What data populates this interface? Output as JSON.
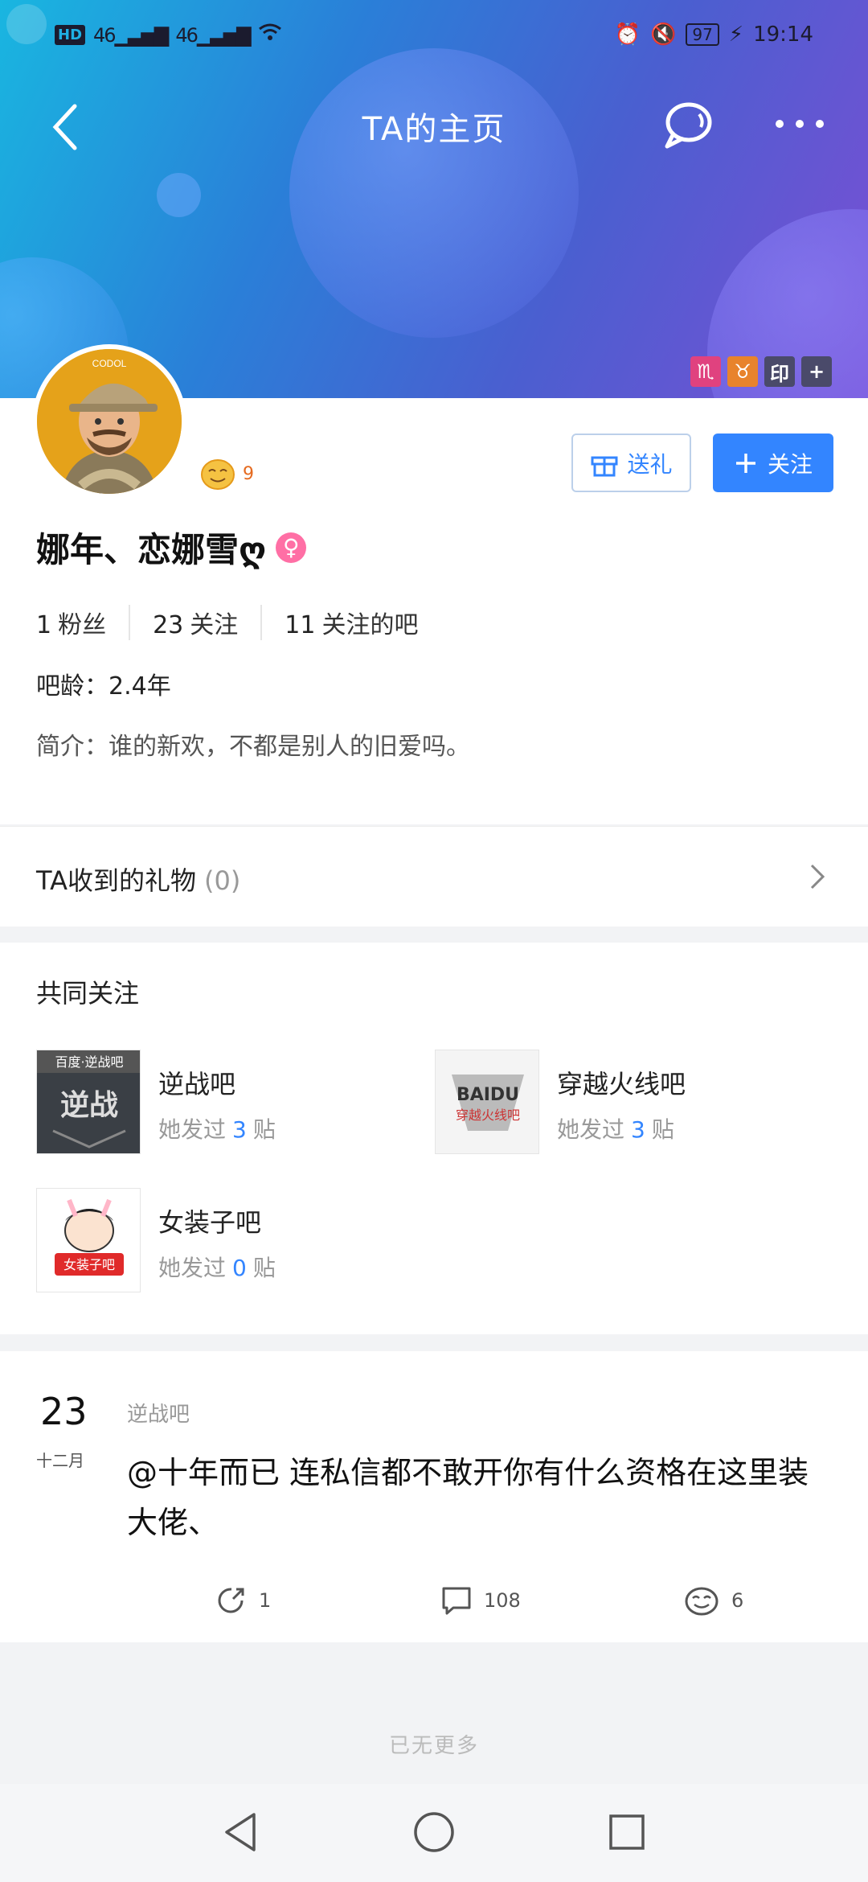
{
  "status_bar": {
    "hd_label": "HD",
    "signal1": "46",
    "signal2": "46",
    "battery": "97",
    "time": "19:14"
  },
  "nav": {
    "title": "TA的主页"
  },
  "tags": [
    {
      "label": "♏",
      "color": "#e0427f"
    },
    {
      "label": "♉",
      "color": "#e8832c"
    },
    {
      "label": "印",
      "color": "#4a4a6a"
    },
    {
      "label": "+",
      "color": "#4a4a6a"
    }
  ],
  "profile": {
    "level": "9",
    "username": "娜年、恋娜雪ღ",
    "gender_icon": "♀",
    "fans_count": "1",
    "fans_label": "粉丝",
    "follow_count": "23",
    "follow_label": "关注",
    "bars_count": "11",
    "bars_label": "关注的吧",
    "age": "吧龄：2.4年",
    "intro": "简介：谁的新欢，不都是别人的旧爱吗。",
    "gift_button": "送礼",
    "follow_button": "关注"
  },
  "gifts": {
    "label": "TA收到的礼物",
    "count": "(0)"
  },
  "common": {
    "title": "共同关注",
    "bars": [
      {
        "name": "逆战吧",
        "prefix": "她发过",
        "count": "3",
        "suffix": "贴"
      },
      {
        "name": "穿越火线吧",
        "prefix": "她发过",
        "count": "3",
        "suffix": "贴"
      },
      {
        "name": "女装子吧",
        "prefix": "她发过",
        "count": "0",
        "suffix": "贴"
      }
    ]
  },
  "post": {
    "day": "23",
    "month": "十二月",
    "bar": "逆战吧",
    "text": "@十年而已 连私信都不敢开你有什么资格在这里装大佬、",
    "shares": "1",
    "comments": "108",
    "likes": "6"
  },
  "footer": {
    "no_more": "已无更多"
  },
  "colors": {
    "accent": "#3385ff",
    "level": "#e56a1f"
  }
}
